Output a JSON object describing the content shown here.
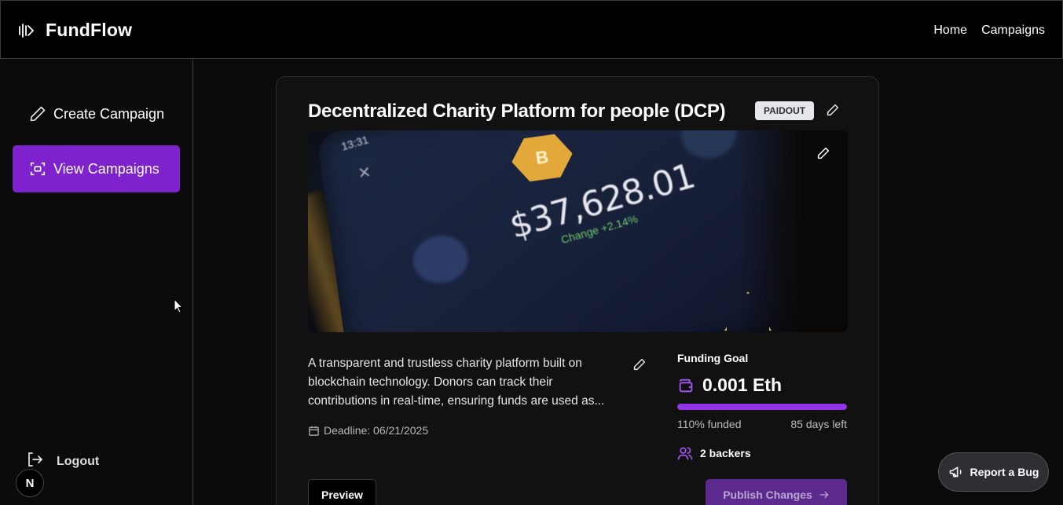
{
  "app": {
    "brand_name": "FundFlow"
  },
  "nav": {
    "home": "Home",
    "campaigns": "Campaigns"
  },
  "sidebar": {
    "create_label": "Create Campaign",
    "view_label": "View Campaigns",
    "logout_label": "Logout",
    "user_initial": "N"
  },
  "campaign": {
    "title": "Decentralized Charity Platform for people (DCP)",
    "status": "PAIDOUT",
    "image": {
      "time": "13:31",
      "coin_symbol": "B",
      "amount": "$37,628.01",
      "change": "Change +2.14%"
    },
    "description": "A transparent and trustless charity platform built on blockchain technology. Donors can track their contributions in real-time, ensuring funds are used as...",
    "deadline": "Deadline: 06/21/2025",
    "goal_label": "Funding Goal",
    "goal_amount": "0.001 Eth",
    "progress_fraction": 1.0,
    "funded_text": "110% funded",
    "days_left": "85 days left",
    "backers": "2 backers"
  },
  "actions": {
    "preview": "Preview",
    "publish": "Publish Changes",
    "report_bug": "Report a Bug"
  },
  "colors": {
    "accent": "#7e22ce",
    "progress": "#9333ea",
    "badge_bg": "#e5e7eb"
  }
}
